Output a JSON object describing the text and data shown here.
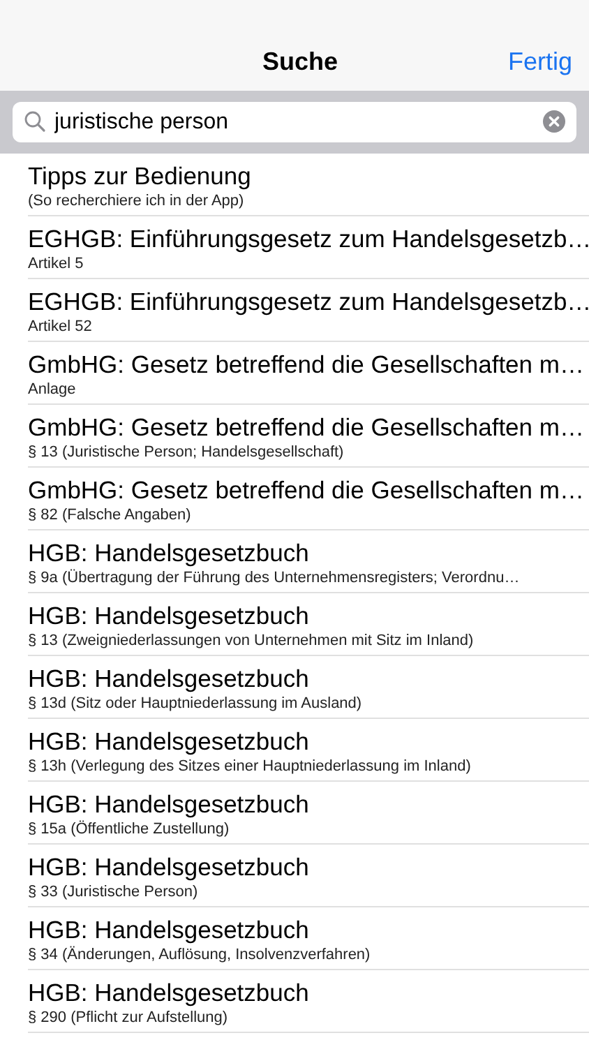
{
  "nav": {
    "title": "Suche",
    "done_button": "Fertig"
  },
  "search": {
    "value": "juristische person"
  },
  "results": [
    {
      "title": "Tipps zur Bedienung",
      "subtitle": " (So recherchiere ich in der App)"
    },
    {
      "title": "EGHGB: Einführungsgesetz zum Handelsgesetzb…",
      "subtitle": "Artikel 5"
    },
    {
      "title": "EGHGB: Einführungsgesetz zum Handelsgesetzb…",
      "subtitle": "Artikel 52"
    },
    {
      "title": "GmbHG: Gesetz betreffend die Gesellschaften m…",
      "subtitle": "Anlage"
    },
    {
      "title": "GmbHG: Gesetz betreffend die Gesellschaften m…",
      "subtitle": "§ 13 (Juristische Person; Handelsgesellschaft)"
    },
    {
      "title": "GmbHG: Gesetz betreffend die Gesellschaften m…",
      "subtitle": "§ 82 (Falsche Angaben)"
    },
    {
      "title": "HGB: Handelsgesetzbuch",
      "subtitle": "§ 9a (Übertragung der Führung des Unternehmensregisters; Verordnu…"
    },
    {
      "title": "HGB: Handelsgesetzbuch",
      "subtitle": "§ 13 (Zweigniederlassungen von Unternehmen mit Sitz im Inland)"
    },
    {
      "title": "HGB: Handelsgesetzbuch",
      "subtitle": "§ 13d (Sitz oder Hauptniederlassung im Ausland)"
    },
    {
      "title": "HGB: Handelsgesetzbuch",
      "subtitle": "§ 13h (Verlegung des Sitzes einer Hauptniederlassung im Inland)"
    },
    {
      "title": "HGB: Handelsgesetzbuch",
      "subtitle": "§ 15a (Öffentliche Zustellung)"
    },
    {
      "title": "HGB: Handelsgesetzbuch",
      "subtitle": "§ 33 (Juristische Person)"
    },
    {
      "title": "HGB: Handelsgesetzbuch",
      "subtitle": "§ 34 (Änderungen, Auflösung, Insolvenzverfahren)"
    },
    {
      "title": "HGB: Handelsgesetzbuch",
      "subtitle": "§ 290 (Pflicht zur Aufstellung)"
    }
  ]
}
